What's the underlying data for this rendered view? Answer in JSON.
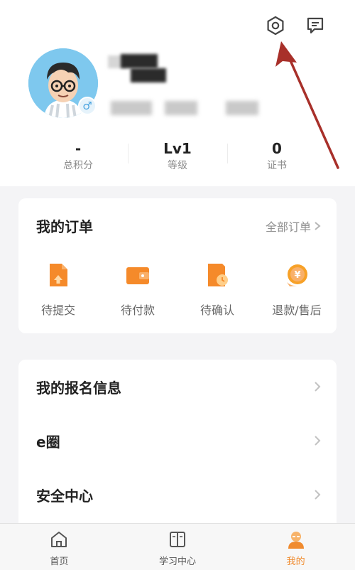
{
  "profile": {
    "gender_symbol": "♂"
  },
  "stats": [
    {
      "value": "-",
      "label": "总积分"
    },
    {
      "value": "Lv1",
      "label": "等级"
    },
    {
      "value": "0",
      "label": "证书"
    }
  ],
  "orders": {
    "title": "我的订单",
    "all_label": "全部订单",
    "items": [
      {
        "label": "待提交",
        "icon": "document-upload-icon"
      },
      {
        "label": "待付款",
        "icon": "wallet-icon"
      },
      {
        "label": "待确认",
        "icon": "document-clock-icon"
      },
      {
        "label": "退款/售后",
        "icon": "yen-coin-icon"
      }
    ]
  },
  "menu": {
    "items": [
      {
        "label": "我的报名信息"
      },
      {
        "label": "e圈"
      },
      {
        "label": "安全中心"
      }
    ]
  },
  "tabbar": {
    "items": [
      {
        "label": "首页",
        "icon": "home-icon"
      },
      {
        "label": "学习中心",
        "icon": "book-icon"
      },
      {
        "label": "我的",
        "icon": "user-icon"
      }
    ],
    "active_index": 2
  },
  "colors": {
    "accent": "#f08b2f",
    "annotation_arrow": "#a8302a",
    "avatar_bg": "#7ec8ee"
  }
}
